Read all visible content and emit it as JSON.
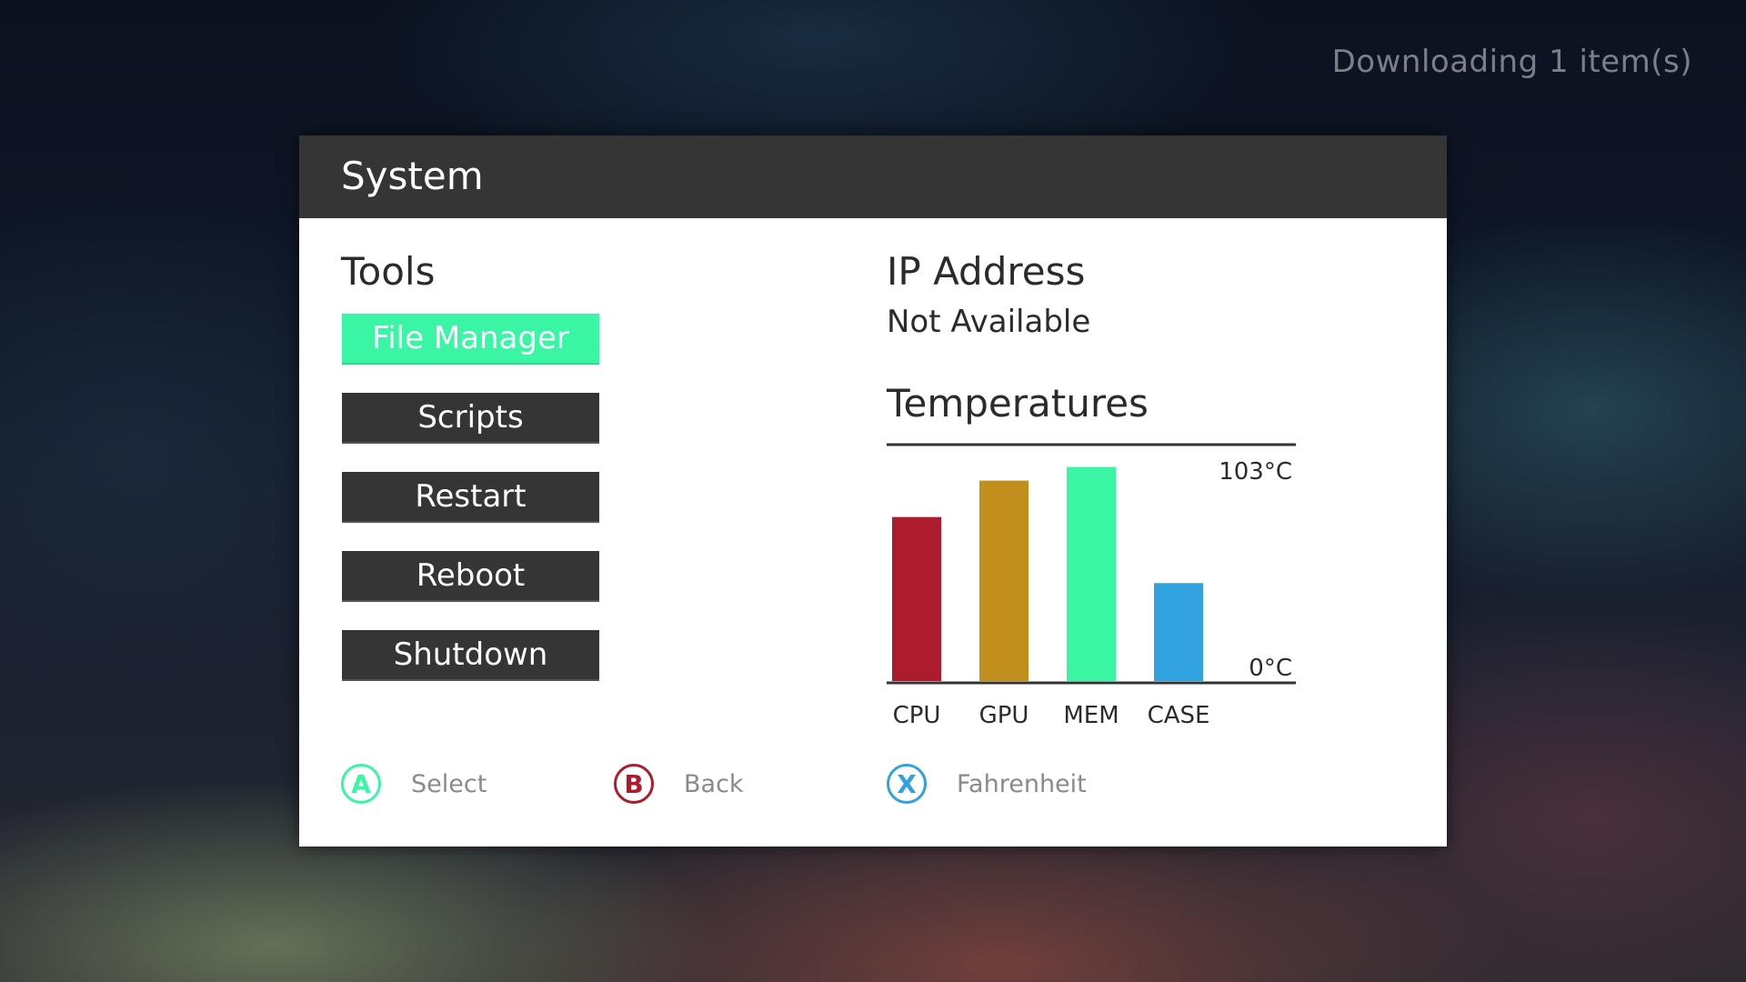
{
  "status": {
    "download": "Downloading 1 item(s)"
  },
  "dialog": {
    "title": "System"
  },
  "tools": {
    "heading": "Tools",
    "buttons": [
      {
        "label": "File Manager",
        "selected": true
      },
      {
        "label": "Scripts",
        "selected": false
      },
      {
        "label": "Restart",
        "selected": false
      },
      {
        "label": "Reboot",
        "selected": false
      },
      {
        "label": "Shutdown",
        "selected": false
      }
    ]
  },
  "network": {
    "heading": "IP Address",
    "value": "Not Available"
  },
  "temperatures": {
    "heading": "Temperatures"
  },
  "chart_data": {
    "type": "bar",
    "categories": [
      "CPU",
      "GPU",
      "MEM",
      "CASE"
    ],
    "values": [
      72,
      88,
      94,
      43
    ],
    "colors": [
      "#ad1c2d",
      "#c28f1f",
      "#3af5a3",
      "#32a1e0"
    ],
    "ylim": [
      0,
      103
    ],
    "max_label": "103°C",
    "min_label": "0°C",
    "unit": "°C"
  },
  "prompts": {
    "a": {
      "glyph": "A",
      "label": "Select",
      "color": "#3af5a3"
    },
    "b": {
      "glyph": "B",
      "label": "Back",
      "color": "#ad1c2d"
    },
    "x": {
      "glyph": "X",
      "label": "Fahrenheit",
      "color": "#32a1e0"
    }
  }
}
